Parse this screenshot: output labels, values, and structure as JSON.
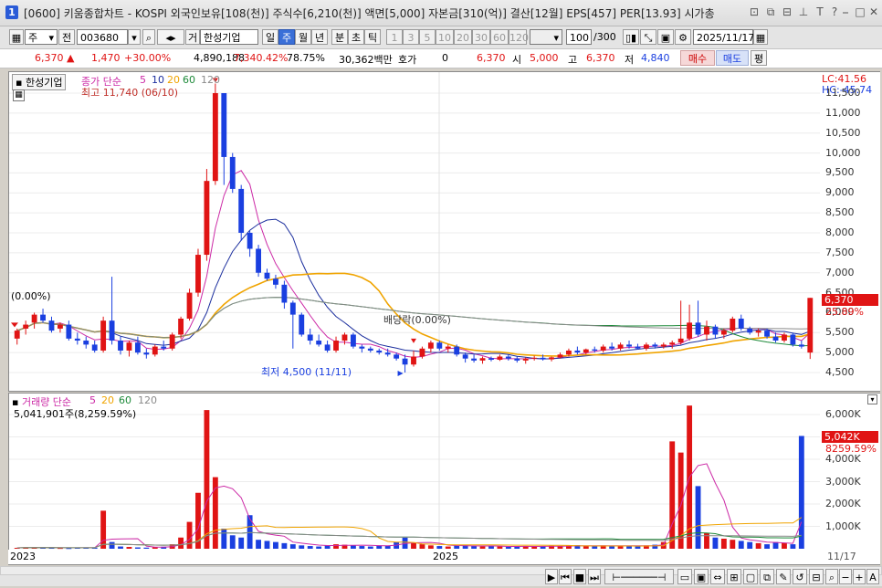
{
  "title_bar": {
    "app_number": "1",
    "title": "[0600] 키움종합차트 - KOSPI 외국인보유[108(천)] 주식수[6,210(천)] 액면[5,000] 자본금[310(억)] 결산[12월] EPS[457] PER[13.93] 시가총"
  },
  "toolbar": {
    "type_select": "주",
    "prev_label": "전",
    "code": "003680",
    "info_label": "거",
    "stock_name": "한성기업",
    "periods": [
      "일",
      "주",
      "월",
      "년",
      "분",
      "초",
      "틱"
    ],
    "selected_period": "주",
    "intervals": [
      "1",
      "3",
      "5",
      "10",
      "20",
      "30",
      "60",
      "120"
    ],
    "count": "100",
    "count_total": "/300",
    "date": "2025/11/17"
  },
  "info_bar": {
    "price": "6,370",
    "change": "1,470",
    "change_rate": "+30.00%",
    "volume": "4,890,188",
    "volume_rate": "7,340.42%",
    "turnover": "78.75%",
    "amount": "30,362백만",
    "quote_label": "호가",
    "quote_value": "0",
    "quote_price": "6,370",
    "open_label": "시",
    "open": "5,000",
    "high_label": "고",
    "high": "6,370",
    "low_label": "저",
    "low": "4,840",
    "buy_label": "매수",
    "sell_label": "매도",
    "eval_label": "평"
  },
  "price_pane": {
    "stock_label": "한성기업",
    "legend_prefix": "종가 단순",
    "ma_periods": [
      "5",
      "10",
      "20",
      "60",
      "120"
    ],
    "lc": "LC:41.56",
    "hc": "HC:-45.74",
    "high_note": "최고 11,740 (06/10)",
    "low_note": "최저 4,500 (11/11)",
    "dividend_note": "배당락(0.00%)",
    "left_note": "(0.00%)",
    "last_price_tag": "6,370",
    "last_rate_tag": "25.89%",
    "y_ticks": [
      "11,500",
      "11,000",
      "10,500",
      "10,000",
      "9,500",
      "9,000",
      "8,500",
      "8,000",
      "7,500",
      "7,000",
      "6,500",
      "6,000",
      "5,500",
      "5,000",
      "4,500"
    ]
  },
  "volume_pane": {
    "legend_label": "거래량 단순",
    "ma_periods": [
      "5",
      "20",
      "60",
      "120"
    ],
    "last_volume_note": "5,041,901주(8,259.59%)",
    "last_volume_tag": "5,042K",
    "last_rate_tag": "8259.59%",
    "y_ticks": [
      "6,000K",
      "5,000K",
      "4,000K",
      "3,000K",
      "2,000K",
      "1,000K"
    ]
  },
  "date_axis": {
    "labels": [
      "2023",
      "2025"
    ],
    "right_label": "11/17"
  },
  "colors": {
    "up": "#e01414",
    "down": "#1a3fe0",
    "ma5": "#cc2aa6",
    "ma10": "#1c2f9e",
    "ma20": "#f0a400",
    "ma60": "#1e8a3a",
    "ma120": "#8a8a8a"
  },
  "chart_data": {
    "type": "candlestick",
    "interval": "weekly",
    "price_range": [
      4400,
      11800
    ],
    "candles": [
      {
        "o": 5350,
        "h": 5600,
        "l": 5200,
        "c": 5550
      },
      {
        "o": 5600,
        "h": 5800,
        "l": 5450,
        "c": 5700
      },
      {
        "o": 5750,
        "h": 6000,
        "l": 5600,
        "c": 5950
      },
      {
        "o": 5950,
        "h": 6100,
        "l": 5750,
        "c": 5800
      },
      {
        "o": 5800,
        "h": 5900,
        "l": 5500,
        "c": 5550
      },
      {
        "o": 5600,
        "h": 5750,
        "l": 5500,
        "c": 5700
      },
      {
        "o": 5700,
        "h": 5800,
        "l": 5300,
        "c": 5350
      },
      {
        "o": 5350,
        "h": 5500,
        "l": 5200,
        "c": 5300
      },
      {
        "o": 5300,
        "h": 5400,
        "l": 5100,
        "c": 5200
      },
      {
        "o": 5200,
        "h": 5300,
        "l": 5000,
        "c": 5050
      },
      {
        "o": 5050,
        "h": 5900,
        "l": 5000,
        "c": 5800
      },
      {
        "o": 5800,
        "h": 6900,
        "l": 5200,
        "c": 5300
      },
      {
        "o": 5300,
        "h": 5400,
        "l": 4950,
        "c": 5050
      },
      {
        "o": 5050,
        "h": 5300,
        "l": 4900,
        "c": 5250
      },
      {
        "o": 5250,
        "h": 5400,
        "l": 4950,
        "c": 5000
      },
      {
        "o": 5000,
        "h": 5100,
        "l": 4850,
        "c": 4950
      },
      {
        "o": 4950,
        "h": 5200,
        "l": 4900,
        "c": 5150
      },
      {
        "o": 5150,
        "h": 5300,
        "l": 5050,
        "c": 5100
      },
      {
        "o": 5100,
        "h": 5500,
        "l": 5050,
        "c": 5450
      },
      {
        "o": 5450,
        "h": 5900,
        "l": 5350,
        "c": 5850
      },
      {
        "o": 5850,
        "h": 6600,
        "l": 5800,
        "c": 6500
      },
      {
        "o": 6500,
        "h": 7600,
        "l": 6400,
        "c": 7450
      },
      {
        "o": 7450,
        "h": 9600,
        "l": 7300,
        "c": 9300
      },
      {
        "o": 9300,
        "h": 11740,
        "l": 9200,
        "c": 11500
      },
      {
        "o": 11500,
        "h": 11500,
        "l": 9200,
        "c": 9900
      },
      {
        "o": 9900,
        "h": 10000,
        "l": 9000,
        "c": 9100
      },
      {
        "o": 9100,
        "h": 9200,
        "l": 7800,
        "c": 8000
      },
      {
        "o": 8000,
        "h": 8050,
        "l": 7400,
        "c": 7600
      },
      {
        "o": 7600,
        "h": 7700,
        "l": 6900,
        "c": 7000
      },
      {
        "o": 7000,
        "h": 7100,
        "l": 6800,
        "c": 6850
      },
      {
        "o": 6850,
        "h": 6950,
        "l": 6600,
        "c": 6700
      },
      {
        "o": 6700,
        "h": 6800,
        "l": 6100,
        "c": 6250
      },
      {
        "o": 6250,
        "h": 6300,
        "l": 5100,
        "c": 5950
      },
      {
        "o": 5950,
        "h": 6000,
        "l": 5400,
        "c": 5450
      },
      {
        "o": 5450,
        "h": 5600,
        "l": 5200,
        "c": 5300
      },
      {
        "o": 5300,
        "h": 5450,
        "l": 5150,
        "c": 5200
      },
      {
        "o": 5200,
        "h": 5300,
        "l": 5000,
        "c": 5050
      },
      {
        "o": 5050,
        "h": 5400,
        "l": 5000,
        "c": 5300
      },
      {
        "o": 5300,
        "h": 5500,
        "l": 5200,
        "c": 5450
      },
      {
        "o": 5450,
        "h": 5500,
        "l": 5100,
        "c": 5150
      },
      {
        "o": 5150,
        "h": 5200,
        "l": 5000,
        "c": 5100
      },
      {
        "o": 5100,
        "h": 5150,
        "l": 5000,
        "c": 5050
      },
      {
        "o": 5050,
        "h": 5100,
        "l": 4950,
        "c": 5000
      },
      {
        "o": 5000,
        "h": 5100,
        "l": 4900,
        "c": 4950
      },
      {
        "o": 4950,
        "h": 5000,
        "l": 4800,
        "c": 4850
      },
      {
        "o": 4850,
        "h": 4950,
        "l": 4500,
        "c": 4700
      },
      {
        "o": 4700,
        "h": 5050,
        "l": 4650,
        "c": 4900
      },
      {
        "o": 4900,
        "h": 5150,
        "l": 4850,
        "c": 5100
      },
      {
        "o": 5100,
        "h": 5300,
        "l": 5000,
        "c": 5250
      },
      {
        "o": 5250,
        "h": 5300,
        "l": 5050,
        "c": 5100
      },
      {
        "o": 5100,
        "h": 5200,
        "l": 5000,
        "c": 5150
      },
      {
        "o": 5150,
        "h": 5200,
        "l": 4900,
        "c": 4950
      },
      {
        "o": 4950,
        "h": 5000,
        "l": 4750,
        "c": 4850
      },
      {
        "o": 4850,
        "h": 4950,
        "l": 4750,
        "c": 4800
      },
      {
        "o": 4800,
        "h": 4900,
        "l": 4720,
        "c": 4860
      },
      {
        "o": 4860,
        "h": 4900,
        "l": 4780,
        "c": 4820
      },
      {
        "o": 4820,
        "h": 4950,
        "l": 4790,
        "c": 4900
      },
      {
        "o": 4900,
        "h": 4950,
        "l": 4800,
        "c": 4850
      },
      {
        "o": 4850,
        "h": 4900,
        "l": 4750,
        "c": 4800
      },
      {
        "o": 4800,
        "h": 4880,
        "l": 4720,
        "c": 4850
      },
      {
        "o": 4850,
        "h": 4920,
        "l": 4800,
        "c": 4870
      },
      {
        "o": 4870,
        "h": 4950,
        "l": 4800,
        "c": 4830
      },
      {
        "o": 4830,
        "h": 4900,
        "l": 4780,
        "c": 4880
      },
      {
        "o": 4880,
        "h": 5000,
        "l": 4850,
        "c": 4950
      },
      {
        "o": 4950,
        "h": 5100,
        "l": 4900,
        "c": 5050
      },
      {
        "o": 5050,
        "h": 5150,
        "l": 4950,
        "c": 5000
      },
      {
        "o": 5000,
        "h": 5100,
        "l": 4950,
        "c": 5080
      },
      {
        "o": 5080,
        "h": 5150,
        "l": 5000,
        "c": 5050
      },
      {
        "o": 5050,
        "h": 5200,
        "l": 5000,
        "c": 5150
      },
      {
        "o": 5150,
        "h": 5250,
        "l": 5050,
        "c": 5100
      },
      {
        "o": 5100,
        "h": 5250,
        "l": 5050,
        "c": 5200
      },
      {
        "o": 5200,
        "h": 5300,
        "l": 5100,
        "c": 5150
      },
      {
        "o": 5150,
        "h": 5220,
        "l": 5080,
        "c": 5100
      },
      {
        "o": 5100,
        "h": 5250,
        "l": 5050,
        "c": 5200
      },
      {
        "o": 5200,
        "h": 5250,
        "l": 5100,
        "c": 5150
      },
      {
        "o": 5150,
        "h": 5250,
        "l": 5100,
        "c": 5200
      },
      {
        "o": 5200,
        "h": 5300,
        "l": 5100,
        "c": 5250
      },
      {
        "o": 5250,
        "h": 6300,
        "l": 5200,
        "c": 5350
      },
      {
        "o": 5350,
        "h": 6200,
        "l": 5300,
        "c": 5750
      },
      {
        "o": 5750,
        "h": 6300,
        "l": 5400,
        "c": 5450
      },
      {
        "o": 5450,
        "h": 5800,
        "l": 5300,
        "c": 5650
      },
      {
        "o": 5650,
        "h": 5700,
        "l": 5350,
        "c": 5450
      },
      {
        "o": 5450,
        "h": 5600,
        "l": 5350,
        "c": 5550
      },
      {
        "o": 5550,
        "h": 5900,
        "l": 5500,
        "c": 5850
      },
      {
        "o": 5850,
        "h": 5950,
        "l": 5550,
        "c": 5600
      },
      {
        "o": 5600,
        "h": 5650,
        "l": 5450,
        "c": 5500
      },
      {
        "o": 5500,
        "h": 5600,
        "l": 5400,
        "c": 5550
      },
      {
        "o": 5550,
        "h": 5600,
        "l": 5350,
        "c": 5400
      },
      {
        "o": 5400,
        "h": 5500,
        "l": 5250,
        "c": 5300
      },
      {
        "o": 5300,
        "h": 5500,
        "l": 5250,
        "c": 5450
      },
      {
        "o": 5450,
        "h": 5500,
        "l": 5150,
        "c": 5200
      },
      {
        "o": 5200,
        "h": 5300,
        "l": 5100,
        "c": 5150
      },
      {
        "o": 5000,
        "h": 6370,
        "l": 4840,
        "c": 6370
      }
    ],
    "volume_k": [
      40,
      60,
      50,
      45,
      40,
      35,
      30,
      60,
      50,
      40,
      1700,
      300,
      100,
      80,
      60,
      50,
      70,
      90,
      200,
      500,
      1200,
      2500,
      6200,
      3200,
      900,
      600,
      500,
      1500,
      400,
      350,
      300,
      250,
      200,
      150,
      120,
      100,
      150,
      200,
      180,
      150,
      120,
      100,
      150,
      130,
      300,
      500,
      250,
      200,
      150,
      120,
      100,
      140,
      160,
      120,
      100,
      110,
      100,
      90,
      110,
      120,
      100,
      110,
      130,
      120,
      140,
      160,
      120,
      110,
      150,
      130,
      140,
      120,
      110,
      150,
      180,
      300,
      4800,
      4300,
      6400,
      2800,
      700,
      500,
      450,
      400,
      350,
      300,
      250,
      200,
      300,
      250,
      200,
      5042
    ]
  }
}
